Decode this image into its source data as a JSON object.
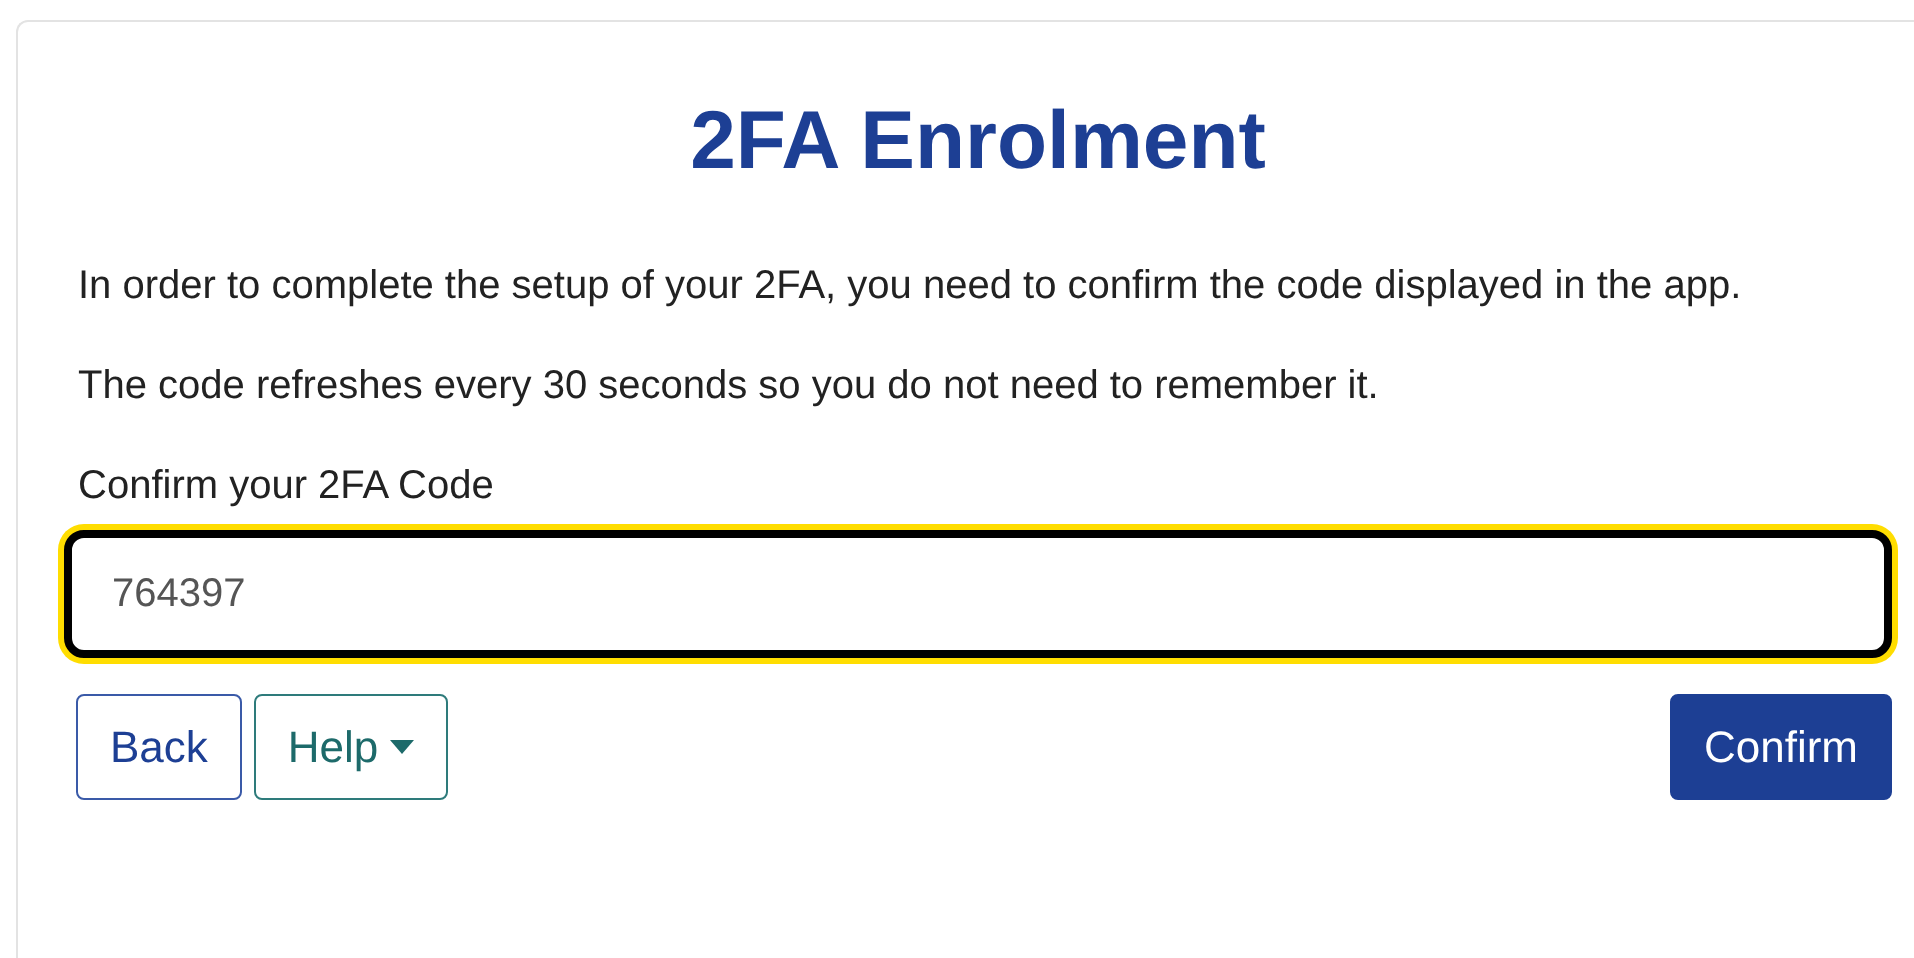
{
  "title": "2FA Enrolment",
  "paragraphs": [
    "In order to complete the setup of your 2FA, you need to confirm the code displayed in the app.",
    "The code refreshes every 30 seconds so you do not need to remember it."
  ],
  "field": {
    "label": "Confirm your 2FA Code",
    "value": "764397",
    "focused": true
  },
  "buttons": [
    {
      "label": "Back",
      "kind": "outline"
    },
    {
      "label": "Help",
      "kind": "dropdown"
    },
    {
      "label": "Confirm",
      "kind": "primary"
    }
  ]
}
